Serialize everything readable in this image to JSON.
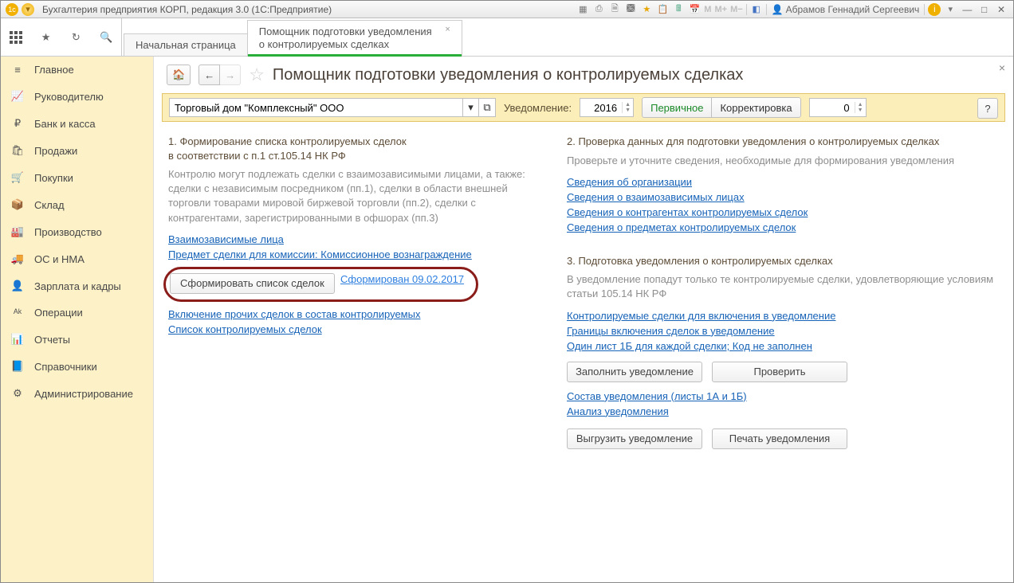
{
  "titlebar": {
    "title": "Бухгалтерия предприятия КОРП, редакция 3.0  (1С:Предприятие)",
    "user": "Абрамов Геннадий Сергеевич"
  },
  "tabs": {
    "start": "Начальная страница",
    "assistant": "Помощник подготовки уведомления о контролируемых сделках"
  },
  "sidebar": {
    "items": [
      {
        "icon": "≡",
        "label": "Главное"
      },
      {
        "icon": "📈",
        "label": "Руководителю"
      },
      {
        "icon": "₽",
        "label": "Банк и касса"
      },
      {
        "icon": "🛍",
        "label": "Продажи"
      },
      {
        "icon": "🛒",
        "label": "Покупки"
      },
      {
        "icon": "📦",
        "label": "Склад"
      },
      {
        "icon": "🏭",
        "label": "Производство"
      },
      {
        "icon": "🚚",
        "label": "ОС и НМА"
      },
      {
        "icon": "👤",
        "label": "Зарплата и кадры"
      },
      {
        "icon": "ᴬᵏ",
        "label": "Операции"
      },
      {
        "icon": "📊",
        "label": "Отчеты"
      },
      {
        "icon": "📘",
        "label": "Справочники"
      },
      {
        "icon": "⚙",
        "label": "Администрирование"
      }
    ]
  },
  "page": {
    "title": "Помощник подготовки уведомления о контролируемых сделках",
    "help": "?"
  },
  "filter": {
    "org_value": "Торговый дом \"Комплексный\" ООО",
    "notice_label": "Уведомление:",
    "year": "2016",
    "primary": "Первичное",
    "correction": "Корректировка",
    "corr_num": "0"
  },
  "step1": {
    "title_line1": "1. Формирование списка контролируемых сделок",
    "title_line2": "в соответствии с п.1 ст.105.14 НК РФ",
    "desc": "Контролю могут подлежать сделки с взаимозависимыми лицами, а также: сделки с независимым посредником (пп.1), сделки в области внешней торговли товарами мировой биржевой торговли (пп.2), сделки с контрагентами, зарегистрированными в офшорах (пп.3)",
    "link_related": "Взаимозависимые лица",
    "link_subject": "Предмет сделки для комиссии: Комиссионное вознаграждение",
    "btn_form": "Сформировать список сделок",
    "status": "Сформирован 09.02.2017",
    "link_include_other": "Включение прочих сделок в состав контролируемых",
    "link_list": "Список контролируемых сделок"
  },
  "step2": {
    "title": "2. Проверка данных для подготовки уведомления о контролируемых сделках",
    "desc": "Проверьте и уточните сведения, необходимые для формирования уведомления",
    "link_org": "Сведения об организации",
    "link_related": "Сведения о взаимозависимых лицах",
    "link_contractors": "Сведения о контрагентах контролируемых сделок",
    "link_subjects": "Сведения о предметах контролируемых сделок"
  },
  "step3": {
    "title": "3. Подготовка уведомления о контролируемых сделках",
    "desc": "В уведомление попадут только те контролируемые сделки, удовлетворяющие условиям статьи 105.14 НК РФ",
    "link_included": "Контролируемые сделки для включения в уведомление",
    "link_limits": "Границы включения сделок в уведомление",
    "link_sheet": "Один лист 1Б для каждой сделки; Код не заполнен",
    "btn_fill": "Заполнить уведомление",
    "btn_check": "Проверить",
    "link_content": "Состав уведомления (листы 1А и 1Б)",
    "link_analysis": "Анализ уведомления",
    "btn_export": "Выгрузить уведомление",
    "btn_print": "Печать уведомления"
  }
}
